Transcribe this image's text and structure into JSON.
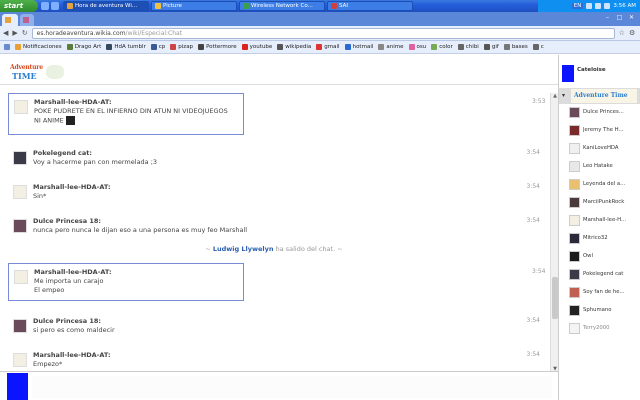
{
  "taskbar": {
    "start_label": "start",
    "tasks": [
      {
        "label": "Hora de aventura Wi...",
        "active": true,
        "color": "#e6a23c"
      },
      {
        "label": "Picture",
        "active": false,
        "color": "#f0c040"
      },
      {
        "label": "Wireless Network Co...",
        "active": false,
        "color": "#3ca04a"
      },
      {
        "label": "SAI",
        "active": false,
        "color": "#d04040"
      }
    ],
    "language": "EN",
    "clock": "3:56 AM"
  },
  "browser": {
    "tabs": [
      {
        "label": "Cateloise"
      },
      {
        "label": ""
      }
    ],
    "address": {
      "domain": "es.horadeaventura.wikia.com",
      "path": "/wiki/Especial:Chat"
    },
    "bookmarks": [
      {
        "label": "Notificaciones",
        "color": "#e8a030"
      },
      {
        "label": "Drago Art",
        "color": "#5a7d3a"
      },
      {
        "label": "HdA tumblr",
        "color": "#34495e"
      },
      {
        "label": "cp",
        "color": "#3b5998"
      },
      {
        "label": "pizap",
        "color": "#c44"
      },
      {
        "label": "Pottermore",
        "color": "#444"
      },
      {
        "label": "youtube",
        "color": "#d22"
      },
      {
        "label": "wikipedia",
        "color": "#555"
      },
      {
        "label": "gmail",
        "color": "#d33"
      },
      {
        "label": "hotmail",
        "color": "#2a6bd1"
      },
      {
        "label": "anime",
        "color": "#888"
      },
      {
        "label": "osu",
        "color": "#e05fa0"
      },
      {
        "label": "color",
        "color": "#7a5"
      },
      {
        "label": "chibi",
        "color": "#666"
      },
      {
        "label": "gif",
        "color": "#555"
      },
      {
        "label": "bases",
        "color": "#777"
      },
      {
        "label": "c",
        "color": "#666"
      }
    ]
  },
  "chat": {
    "logo": {
      "line1": "Adventure",
      "line2": "TIME"
    },
    "messages": [
      {
        "user": "Marshall-lee-HDA-AT:",
        "lines": [
          "POKE PUDRETE EN EL INFIERNO DIN ATUN NI VIDEOJUEGOS",
          "NI ANIME"
        ],
        "time": "3:53",
        "highlight": true,
        "avatar": "light"
      },
      {
        "user": "Pokelegend cat:",
        "lines": [
          "Voy a hacerme pan con mermelada ;3"
        ],
        "time": "3:54",
        "highlight": false,
        "avatar": "dark"
      },
      {
        "user": "Marshall-lee-HDA-AT:",
        "lines": [
          "Sin*"
        ],
        "time": "3:54",
        "highlight": false,
        "avatar": "light"
      },
      {
        "user": "Dulce Princesa 18:",
        "lines": [
          "nunca pero nunca le dijan eso a una persona es muy feo Marshall"
        ],
        "time": "3:54",
        "highlight": false,
        "avatar": "pb"
      },
      {
        "user": "Marshall-lee-HDA-AT:",
        "lines": [
          "Me importa un carajo",
          "El empeo"
        ],
        "time": "3:54",
        "highlight": true,
        "avatar": "light"
      },
      {
        "user": "Dulce Princesa 18:",
        "lines": [
          "si pero es como maldecir"
        ],
        "time": "3:54",
        "highlight": false,
        "avatar": "pb"
      },
      {
        "user": "Marshall-lee-HDA-AT:",
        "lines": [
          "Empezo*"
        ],
        "time": "3:54",
        "highlight": false,
        "avatar": "light"
      }
    ],
    "inform": {
      "prefix": "~ ",
      "name": "Ludwig Llywelyn",
      "text": " ha salido del chat. ~"
    }
  },
  "userlist": {
    "me": "Cateloise",
    "wiki_label": "Adventure Time",
    "users": [
      {
        "name": "Dulce Princes...",
        "color": "#6b4a5a",
        "away": false
      },
      {
        "name": "Jeremy The H...",
        "color": "#7a2a2a",
        "away": false
      },
      {
        "name": "KaniLoveHDA",
        "color": "#f0f0f0",
        "away": false
      },
      {
        "name": "Leo Hatake",
        "color": "#e8e8e8",
        "away": false
      },
      {
        "name": "Leyenda del a...",
        "color": "#e8c070",
        "away": false
      },
      {
        "name": "MarciiPunkRock",
        "color": "#4a3a3a",
        "away": false
      },
      {
        "name": "Marshall-lee-H...",
        "color": "#f3efe2",
        "away": false
      },
      {
        "name": "Mitrico32",
        "color": "#2a2a3a",
        "away": false
      },
      {
        "name": "Owl",
        "color": "#1a1a1a",
        "away": false
      },
      {
        "name": "Pokelegend cat",
        "color": "#3a3a48",
        "away": false
      },
      {
        "name": "Soy fan de he...",
        "color": "#c06050",
        "away": false
      },
      {
        "name": "Sphumano",
        "color": "#222",
        "away": false
      },
      {
        "name": "Terry2000",
        "color": "#f4f4f4",
        "away": true
      }
    ]
  }
}
